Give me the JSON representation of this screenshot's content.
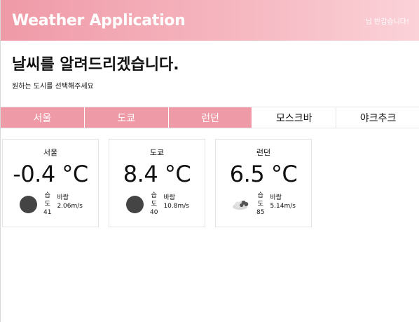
{
  "header": {
    "title": "Weather Application",
    "greeting": "님 반갑습니다!"
  },
  "intro": {
    "heading": "날씨를 알려드리겠습니다.",
    "subheading": "원하는 도시를 선택해주세요"
  },
  "tabs": [
    {
      "label": "서울",
      "selected": true
    },
    {
      "label": "도쿄",
      "selected": true
    },
    {
      "label": "런던",
      "selected": true
    },
    {
      "label": "모스크바",
      "selected": false
    },
    {
      "label": "야크추크",
      "selected": false
    }
  ],
  "cards": [
    {
      "city": "서울",
      "temp": "-0.4 °C",
      "icon": "clear-night-icon",
      "humidity_label": "습도",
      "humidity": "41",
      "wind_label": "바람",
      "wind": "2.06m/s"
    },
    {
      "city": "도쿄",
      "temp": "8.4 °C",
      "icon": "clear-night-icon",
      "humidity_label": "습도",
      "humidity": "40",
      "wind_label": "바람",
      "wind": "10.8m/s"
    },
    {
      "city": "런던",
      "temp": "6.5 °C",
      "icon": "cloudy-night-icon",
      "humidity_label": "습도",
      "humidity": "85",
      "wind_label": "바람",
      "wind": "5.14m/s"
    }
  ],
  "colors": {
    "accent": "#ef9aa7",
    "header_gradient_end": "#fbd2d8",
    "icon_dark": "#444444"
  }
}
